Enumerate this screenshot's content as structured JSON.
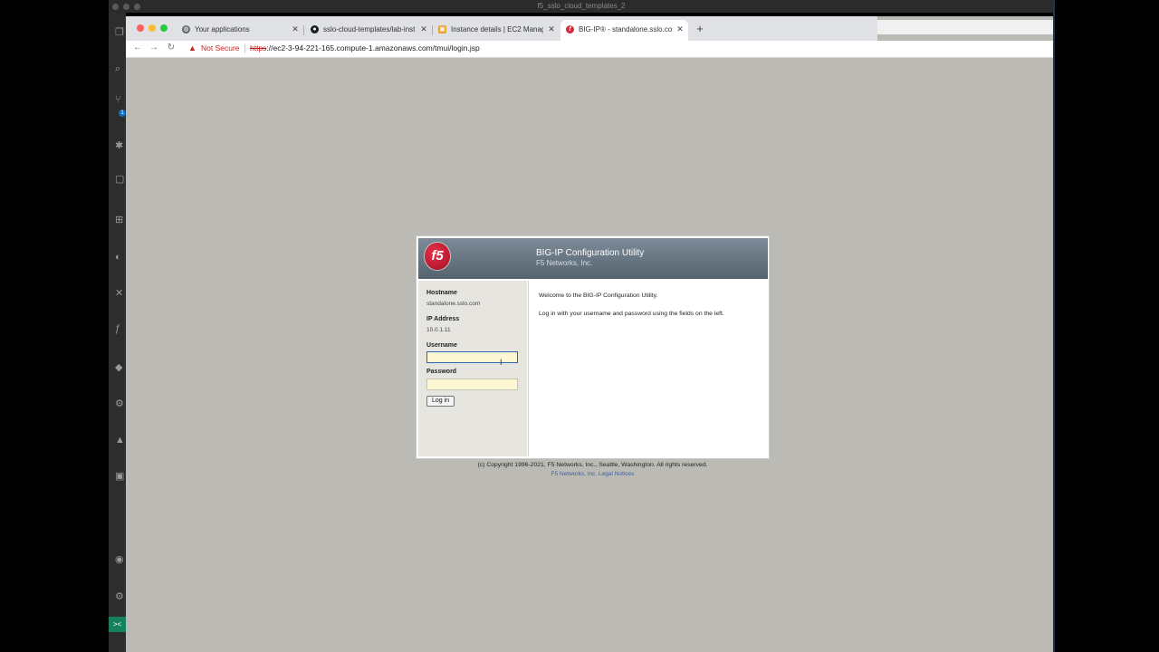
{
  "vscode": {
    "window_title": "f5_sslo_cloud_templates_2",
    "badge_count": "1",
    "remote_icon": "><"
  },
  "browser": {
    "tabs": [
      {
        "label": "Your applications",
        "icon": "globe-icon",
        "icon_color": "#5f6368"
      },
      {
        "label": "sslo-cloud-templates/lab-inst",
        "icon": "github-icon",
        "icon_color": "#1b1f23"
      },
      {
        "label": "Instance details | EC2 Manage",
        "icon": "aws-icon",
        "icon_color": "#e8a030"
      },
      {
        "label": "BIG-IP® - standalone.sslo.com",
        "icon": "f5-icon",
        "icon_color": "#d6293f"
      }
    ],
    "new_tab_label": "+",
    "not_secure_label": "Not Secure",
    "url_scheme": "https",
    "url_rest": "://ec2-3-94-221-165.compute-1.amazonaws.com/tmui/login.jsp"
  },
  "login": {
    "logo_text": "f5",
    "header_title": "BIG-IP Configuration Utility",
    "header_subtitle": "F5 Networks, Inc.",
    "hostname_label": "Hostname",
    "hostname_value": "standalone.sslo.com",
    "ip_label": "IP Address",
    "ip_value": "10.0.1.11",
    "username_label": "Username",
    "username_value": "",
    "password_label": "Password",
    "password_value": "",
    "login_button": "Log in",
    "welcome_text": "Welcome to the BIG-IP Configuration Utility.",
    "instructions_text": "Log in with your username and password using the fields on the left.",
    "copyright": "(c) Copyright 1996-2021, F5 Networks, Inc., Seattle, Washington. All rights reserved.",
    "legal_link": "F5 Networks, Inc. Legal Notices"
  },
  "colors": {
    "browser_bg": "#bbbab4",
    "header_gradient_top": "#7d8b98",
    "f5_red": "#d6293f",
    "not_secure_red": "#c5221f",
    "vscode_remote_green": "#16825d"
  }
}
